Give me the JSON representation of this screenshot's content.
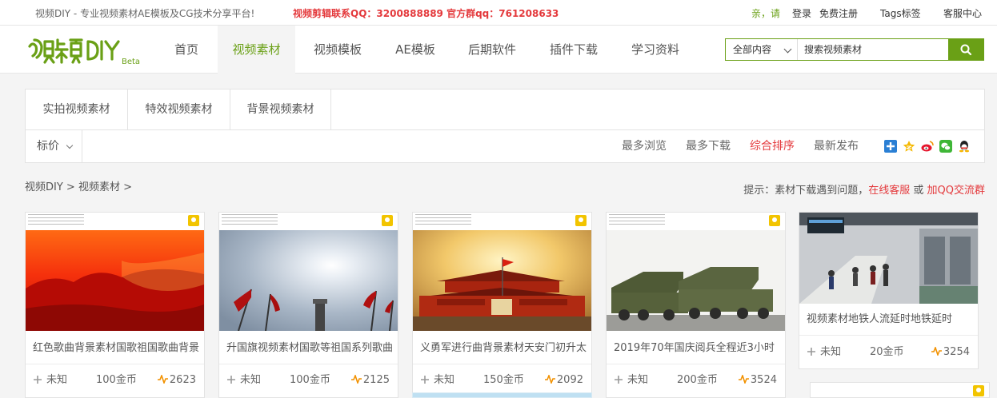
{
  "topbar": {
    "slogan": "视频DIY - 专业视频素材AE模板及CG技术分享平台!",
    "contact": "视频剪辑联系QQ：3200888889 官方群qq：761208633",
    "greeting": "亲，请",
    "login": "登录",
    "register": "免费注册",
    "tags": "Tags标签",
    "service": "客服中心"
  },
  "logo": {
    "text": "视频DIY",
    "beta": "Beta"
  },
  "nav": [
    "首页",
    "视频素材",
    "视频模板",
    "AE模板",
    "后期软件",
    "插件下载",
    "学习资料"
  ],
  "search": {
    "scope": "全部内容",
    "placeholder": "搜索视频素材"
  },
  "categories": [
    "实拍视频素材",
    "特效视频素材",
    "背景视频素材"
  ],
  "filter": {
    "price": "标价",
    "sorts": [
      "最多浏览",
      "最多下载",
      "综合排序",
      "最新发布"
    ],
    "share_icons": [
      "plus-share-icon",
      "qzone-icon",
      "weibo-icon",
      "wechat-icon",
      "qq-icon"
    ]
  },
  "breadcrumb": "视频DIY > 视频素材 >",
  "tip": {
    "prefix": "提示：素材下载遇到问题，",
    "link1": "在线客服",
    "or": " 或 ",
    "link2": "加QQ交流群"
  },
  "cards": [
    {
      "title": "红色歌曲背景素材国歌祖国歌曲背景",
      "res": "未知",
      "price": "100金币",
      "views": "2623"
    },
    {
      "title": "升国旗视频素材国歌等祖国系列歌曲",
      "res": "未知",
      "price": "100金币",
      "views": "2125"
    },
    {
      "title": "义勇军进行曲背景素材天安门初升太",
      "res": "未知",
      "price": "150金币",
      "views": "2092"
    },
    {
      "title": "2019年70年国庆阅兵全程近3小时",
      "res": "未知",
      "price": "200金币",
      "views": "3524"
    },
    {
      "title": "视频素材地铁人流延时地铁延时",
      "res": "未知",
      "price": "20金币",
      "views": "3254"
    }
  ],
  "colors": {
    "accent": "#6aa016",
    "red": "#e4393c"
  }
}
